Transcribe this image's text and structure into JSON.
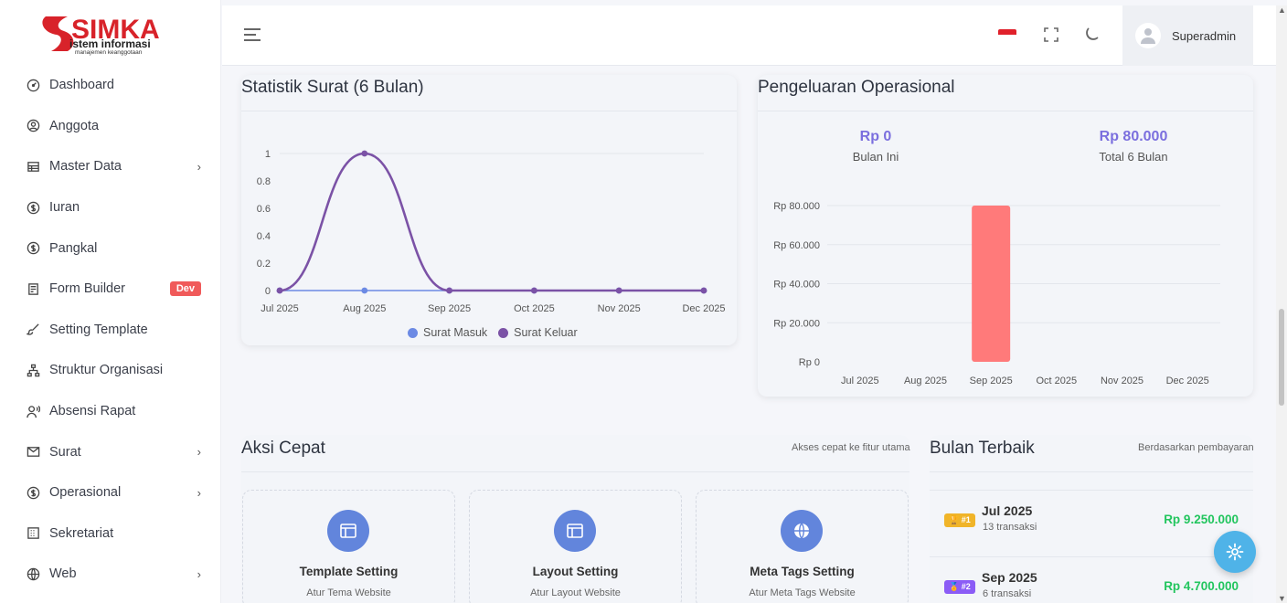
{
  "brand": {
    "logo_main": "SIMKA",
    "logo_line1": "istem informasi",
    "logo_line2": "manajemen keanggotaan",
    "color": "#d8232a"
  },
  "sidebar": {
    "items": [
      {
        "label": "Dashboard",
        "icon": "dashboard-icon"
      },
      {
        "label": "Anggota",
        "icon": "user-circle-icon"
      },
      {
        "label": "Master Data",
        "icon": "table-icon",
        "has_submenu": true
      },
      {
        "label": "Iuran",
        "icon": "coins-icon"
      },
      {
        "label": "Pangkal",
        "icon": "dollar-circle-icon"
      },
      {
        "label": "Form Builder",
        "icon": "form-icon",
        "badge": "Dev"
      },
      {
        "label": "Setting Template",
        "icon": "brush-icon"
      },
      {
        "label": "Struktur Organisasi",
        "icon": "hierarchy-icon"
      },
      {
        "label": "Absensi Rapat",
        "icon": "user-voice-icon"
      },
      {
        "label": "Surat",
        "icon": "mail-icon",
        "has_submenu": true
      },
      {
        "label": "Operasional",
        "icon": "dollar-circle-icon",
        "has_submenu": true
      },
      {
        "label": "Sekretariat",
        "icon": "building-icon"
      },
      {
        "label": "Web",
        "icon": "globe-icon",
        "has_submenu": true
      }
    ]
  },
  "topbar": {
    "username": "Superadmin",
    "icons": [
      "menu-icon",
      "flag-id-icon",
      "fullscreen-icon",
      "moon-icon",
      "avatar-icon"
    ]
  },
  "statistik": {
    "title": "Statistik Surat (6 Bulan)",
    "chart_data": {
      "type": "line",
      "x": [
        "Jul 2025",
        "Aug 2025",
        "Sep 2025",
        "Oct 2025",
        "Nov 2025",
        "Dec 2025"
      ],
      "yticks": [
        "0",
        "0.2",
        "0.4",
        "0.6",
        "0.8",
        "1"
      ],
      "ylim": [
        0,
        1
      ],
      "series": [
        {
          "name": "Surat Masuk",
          "color": "#6c8ae4",
          "values": [
            0,
            0,
            0,
            0,
            0,
            0
          ]
        },
        {
          "name": "Surat Keluar",
          "color": "#7b52a6",
          "values": [
            0,
            1,
            0,
            0,
            0,
            0
          ]
        }
      ],
      "legend": "bottom"
    }
  },
  "pengeluaran": {
    "title": "Pengeluaran Operasional",
    "bulan_ini_value": "Rp 0",
    "bulan_ini_label": "Bulan Ini",
    "total_value": "Rp 80.000",
    "total_label": "Total 6 Bulan",
    "chart_data": {
      "type": "bar",
      "categories": [
        "Jul 2025",
        "Aug 2025",
        "Sep 2025",
        "Oct 2025",
        "Nov 2025",
        "Dec 2025"
      ],
      "values": [
        0,
        0,
        80000,
        0,
        0,
        0
      ],
      "yticks": [
        "Rp 0",
        "Rp 20.000",
        "Rp 40.000",
        "Rp 60.000",
        "Rp 80.000"
      ],
      "ylim": [
        0,
        80000
      ],
      "bar_color": "#ff7a7a"
    }
  },
  "aksi_cepat": {
    "title": "Aksi Cepat",
    "subtitle": "Akses cepat ke fitur utama",
    "tiles": [
      {
        "title": "Template Setting",
        "sub": "Atur Tema Website",
        "icon": "layout-icon"
      },
      {
        "title": "Layout Setting",
        "sub": "Atur Layout Website",
        "icon": "layout-icon"
      },
      {
        "title": "Meta Tags Setting",
        "sub": "Atur Meta Tags Website",
        "icon": "globe-icon"
      }
    ]
  },
  "bulan_terbaik": {
    "title": "Bulan Terbaik",
    "subtitle": "Berdasarkan pembayaran",
    "rows": [
      {
        "rank": "#1",
        "month": "Jul 2025",
        "count": "13 transaksi",
        "amount": "Rp 9.250.000",
        "badge_color": "#f0b429"
      },
      {
        "rank": "#2",
        "month": "Sep 2025",
        "count": "6 transaksi",
        "amount": "Rp 4.700.000",
        "badge_color": "#8b5cf6"
      }
    ]
  }
}
